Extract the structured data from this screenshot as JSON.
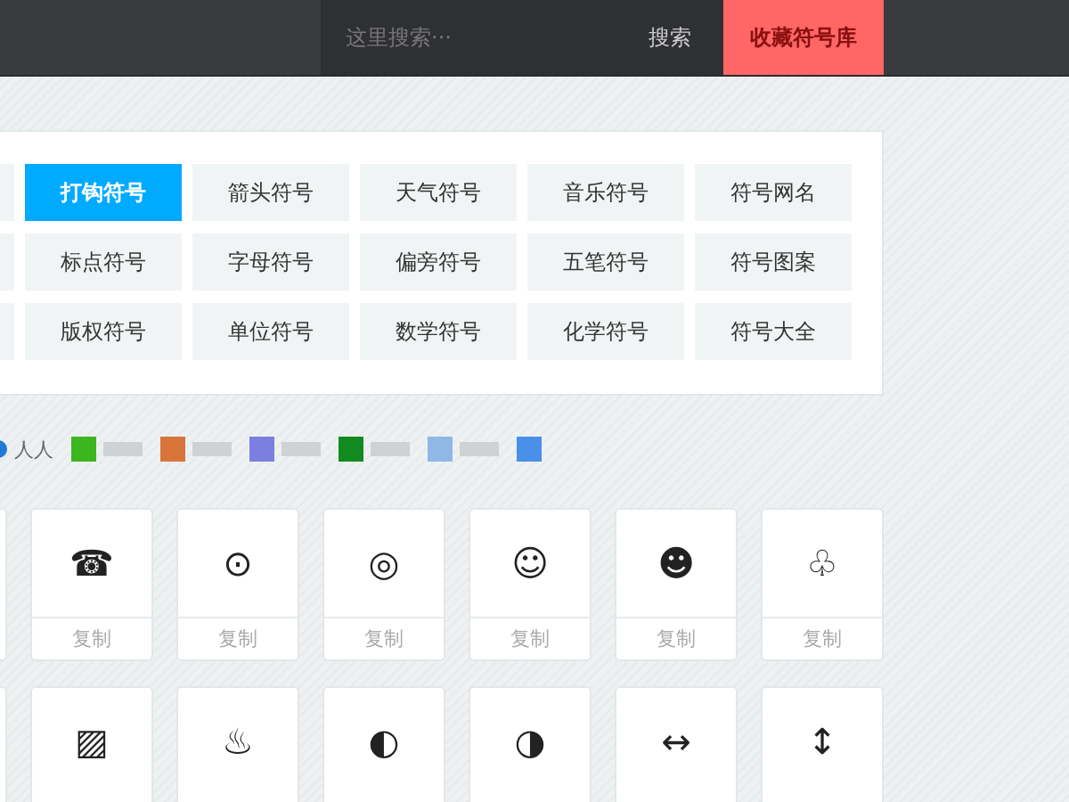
{
  "header": {
    "search": {
      "placeholder": "这里搜索···"
    },
    "search_button": "搜索",
    "favorites_button": "收藏符号库"
  },
  "categories": [
    {
      "label": "打钩符号",
      "selected": true
    },
    {
      "label": "箭头符号",
      "selected": false
    },
    {
      "label": "天气符号",
      "selected": false
    },
    {
      "label": "音乐符号",
      "selected": false
    },
    {
      "label": "符号网名",
      "selected": false
    },
    {
      "label": "标点符号",
      "selected": false
    },
    {
      "label": "字母符号",
      "selected": false
    },
    {
      "label": "偏旁符号",
      "selected": false
    },
    {
      "label": "五笔符号",
      "selected": false
    },
    {
      "label": "符号图案",
      "selected": false
    },
    {
      "label": "版权符号",
      "selected": false
    },
    {
      "label": "单位符号",
      "selected": false
    },
    {
      "label": "数学符号",
      "selected": false
    },
    {
      "label": "化学符号",
      "selected": false
    },
    {
      "label": "符号大全",
      "selected": false
    }
  ],
  "share": {
    "first_label": "人人",
    "icons": [
      {
        "color": "#3db51f"
      },
      {
        "color": "#d9743a"
      },
      {
        "color": "#7b7fe0"
      },
      {
        "color": "#138a1f"
      },
      {
        "color": "#8fb8e6"
      },
      {
        "color": "#4a90e8"
      }
    ]
  },
  "symbol_rows": [
    {
      "symbols": [
        {
          "char": "☎",
          "copy": "复制"
        },
        {
          "char": "⊙",
          "copy": "复制"
        },
        {
          "char": "◎",
          "copy": "复制"
        },
        {
          "char": "☺",
          "copy": "复制"
        },
        {
          "char": "☻",
          "copy": "复制"
        },
        {
          "char": "♧",
          "copy": "复制"
        }
      ]
    },
    {
      "symbols": [
        {
          "char": "▨"
        },
        {
          "char": "♨"
        },
        {
          "char": "◐"
        },
        {
          "char": "◑"
        },
        {
          "char": "↔"
        },
        {
          "char": "↕"
        }
      ]
    }
  ]
}
